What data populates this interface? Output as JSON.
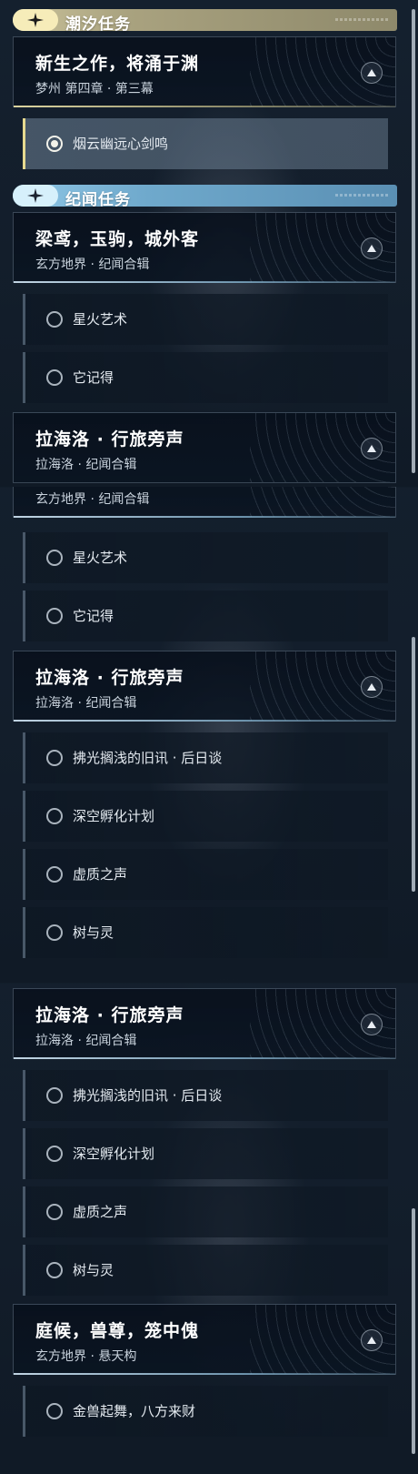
{
  "panel1": {
    "tide_section": {
      "title": "潮汐任务"
    },
    "quest_tide": {
      "title": "新生之作，将涌于渊",
      "subtitle": "梦州 第四章 · 第三幕"
    },
    "tide_items": [
      {
        "label": "烟云幽远心剑鸣",
        "active": true
      }
    ],
    "lore_section": {
      "title": "纪闻任务"
    },
    "quest_liangyuan": {
      "title": "梁鸢，玉驹，城外客",
      "subtitle": "玄方地界 · 纪闻合辑"
    },
    "liangyuan_items": [
      {
        "label": "星火艺术"
      },
      {
        "label": "它记得"
      }
    ],
    "quest_lahailuo": {
      "title": "拉海洛 · 行旅旁声",
      "subtitle": "拉海洛 · 纪闻合辑"
    }
  },
  "panel2": {
    "quest_liangyuan_partial": {
      "subtitle": "玄方地界 · 纪闻合辑"
    },
    "liangyuan_items": [
      {
        "label": "星火艺术"
      },
      {
        "label": "它记得"
      }
    ],
    "quest_lahailuo": {
      "title": "拉海洛 · 行旅旁声",
      "subtitle": "拉海洛 · 纪闻合辑"
    },
    "lahailuo_items": [
      {
        "label": "拂光搁浅的旧讯 · 后日谈"
      },
      {
        "label": "深空孵化计划"
      },
      {
        "label": "虚质之声"
      },
      {
        "label": "树与灵"
      }
    ]
  },
  "panel3": {
    "quest_lahailuo": {
      "title": "拉海洛 · 行旅旁声",
      "subtitle": "拉海洛 · 纪闻合辑"
    },
    "lahailuo_items": [
      {
        "label": "拂光搁浅的旧讯 · 后日谈"
      },
      {
        "label": "深空孵化计划"
      },
      {
        "label": "虚质之声"
      },
      {
        "label": "树与灵"
      }
    ],
    "quest_tinghou": {
      "title": "庭候，兽尊，笼中傀",
      "subtitle": "玄方地界 · 悬天构"
    },
    "tinghou_items": [
      {
        "label": "金兽起舞，八方来财"
      }
    ]
  },
  "icons": {
    "section_icon": "four-point-star-icon",
    "collapse_icon": "triangle-up-icon",
    "radio_icon": "radio-circle-icon"
  },
  "colors": {
    "tide_accent": "#f6ecb9",
    "lore_accent": "#8fc7e6",
    "active_bar": "#e6d98f"
  }
}
